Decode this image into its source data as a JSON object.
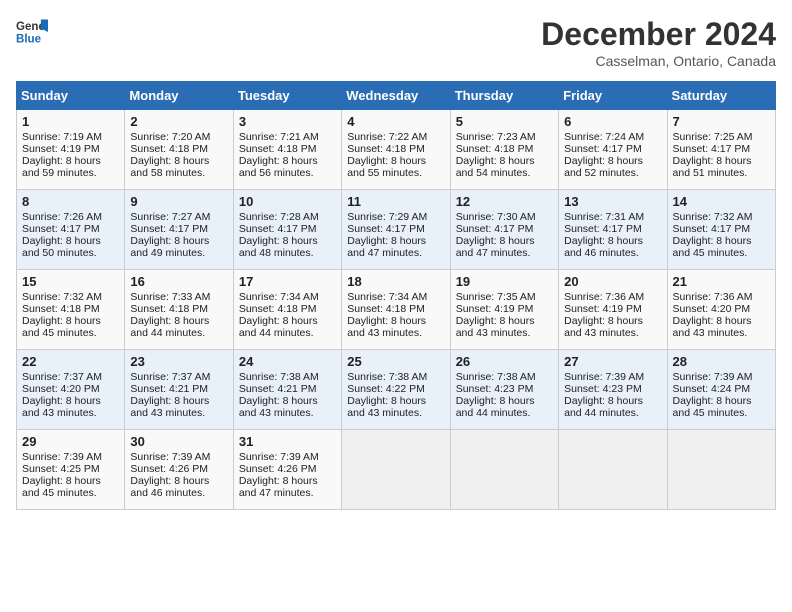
{
  "header": {
    "logo_line1": "General",
    "logo_line2": "Blue",
    "month": "December 2024",
    "location": "Casselman, Ontario, Canada"
  },
  "days_of_week": [
    "Sunday",
    "Monday",
    "Tuesday",
    "Wednesday",
    "Thursday",
    "Friday",
    "Saturday"
  ],
  "weeks": [
    [
      {
        "day": 1,
        "rise": "7:19 AM",
        "set": "4:19 PM",
        "daylight": "8 hours and 59 minutes."
      },
      {
        "day": 2,
        "rise": "7:20 AM",
        "set": "4:18 PM",
        "daylight": "8 hours and 58 minutes."
      },
      {
        "day": 3,
        "rise": "7:21 AM",
        "set": "4:18 PM",
        "daylight": "8 hours and 56 minutes."
      },
      {
        "day": 4,
        "rise": "7:22 AM",
        "set": "4:18 PM",
        "daylight": "8 hours and 55 minutes."
      },
      {
        "day": 5,
        "rise": "7:23 AM",
        "set": "4:18 PM",
        "daylight": "8 hours and 54 minutes."
      },
      {
        "day": 6,
        "rise": "7:24 AM",
        "set": "4:17 PM",
        "daylight": "8 hours and 52 minutes."
      },
      {
        "day": 7,
        "rise": "7:25 AM",
        "set": "4:17 PM",
        "daylight": "8 hours and 51 minutes."
      }
    ],
    [
      {
        "day": 8,
        "rise": "7:26 AM",
        "set": "4:17 PM",
        "daylight": "8 hours and 50 minutes."
      },
      {
        "day": 9,
        "rise": "7:27 AM",
        "set": "4:17 PM",
        "daylight": "8 hours and 49 minutes."
      },
      {
        "day": 10,
        "rise": "7:28 AM",
        "set": "4:17 PM",
        "daylight": "8 hours and 48 minutes."
      },
      {
        "day": 11,
        "rise": "7:29 AM",
        "set": "4:17 PM",
        "daylight": "8 hours and 47 minutes."
      },
      {
        "day": 12,
        "rise": "7:30 AM",
        "set": "4:17 PM",
        "daylight": "8 hours and 47 minutes."
      },
      {
        "day": 13,
        "rise": "7:31 AM",
        "set": "4:17 PM",
        "daylight": "8 hours and 46 minutes."
      },
      {
        "day": 14,
        "rise": "7:32 AM",
        "set": "4:17 PM",
        "daylight": "8 hours and 45 minutes."
      }
    ],
    [
      {
        "day": 15,
        "rise": "7:32 AM",
        "set": "4:18 PM",
        "daylight": "8 hours and 45 minutes."
      },
      {
        "day": 16,
        "rise": "7:33 AM",
        "set": "4:18 PM",
        "daylight": "8 hours and 44 minutes."
      },
      {
        "day": 17,
        "rise": "7:34 AM",
        "set": "4:18 PM",
        "daylight": "8 hours and 44 minutes."
      },
      {
        "day": 18,
        "rise": "7:34 AM",
        "set": "4:18 PM",
        "daylight": "8 hours and 43 minutes."
      },
      {
        "day": 19,
        "rise": "7:35 AM",
        "set": "4:19 PM",
        "daylight": "8 hours and 43 minutes."
      },
      {
        "day": 20,
        "rise": "7:36 AM",
        "set": "4:19 PM",
        "daylight": "8 hours and 43 minutes."
      },
      {
        "day": 21,
        "rise": "7:36 AM",
        "set": "4:20 PM",
        "daylight": "8 hours and 43 minutes."
      }
    ],
    [
      {
        "day": 22,
        "rise": "7:37 AM",
        "set": "4:20 PM",
        "daylight": "8 hours and 43 minutes."
      },
      {
        "day": 23,
        "rise": "7:37 AM",
        "set": "4:21 PM",
        "daylight": "8 hours and 43 minutes."
      },
      {
        "day": 24,
        "rise": "7:38 AM",
        "set": "4:21 PM",
        "daylight": "8 hours and 43 minutes."
      },
      {
        "day": 25,
        "rise": "7:38 AM",
        "set": "4:22 PM",
        "daylight": "8 hours and 43 minutes."
      },
      {
        "day": 26,
        "rise": "7:38 AM",
        "set": "4:23 PM",
        "daylight": "8 hours and 44 minutes."
      },
      {
        "day": 27,
        "rise": "7:39 AM",
        "set": "4:23 PM",
        "daylight": "8 hours and 44 minutes."
      },
      {
        "day": 28,
        "rise": "7:39 AM",
        "set": "4:24 PM",
        "daylight": "8 hours and 45 minutes."
      }
    ],
    [
      {
        "day": 29,
        "rise": "7:39 AM",
        "set": "4:25 PM",
        "daylight": "8 hours and 45 minutes."
      },
      {
        "day": 30,
        "rise": "7:39 AM",
        "set": "4:26 PM",
        "daylight": "8 hours and 46 minutes."
      },
      {
        "day": 31,
        "rise": "7:39 AM",
        "set": "4:26 PM",
        "daylight": "8 hours and 47 minutes."
      },
      null,
      null,
      null,
      null
    ]
  ]
}
